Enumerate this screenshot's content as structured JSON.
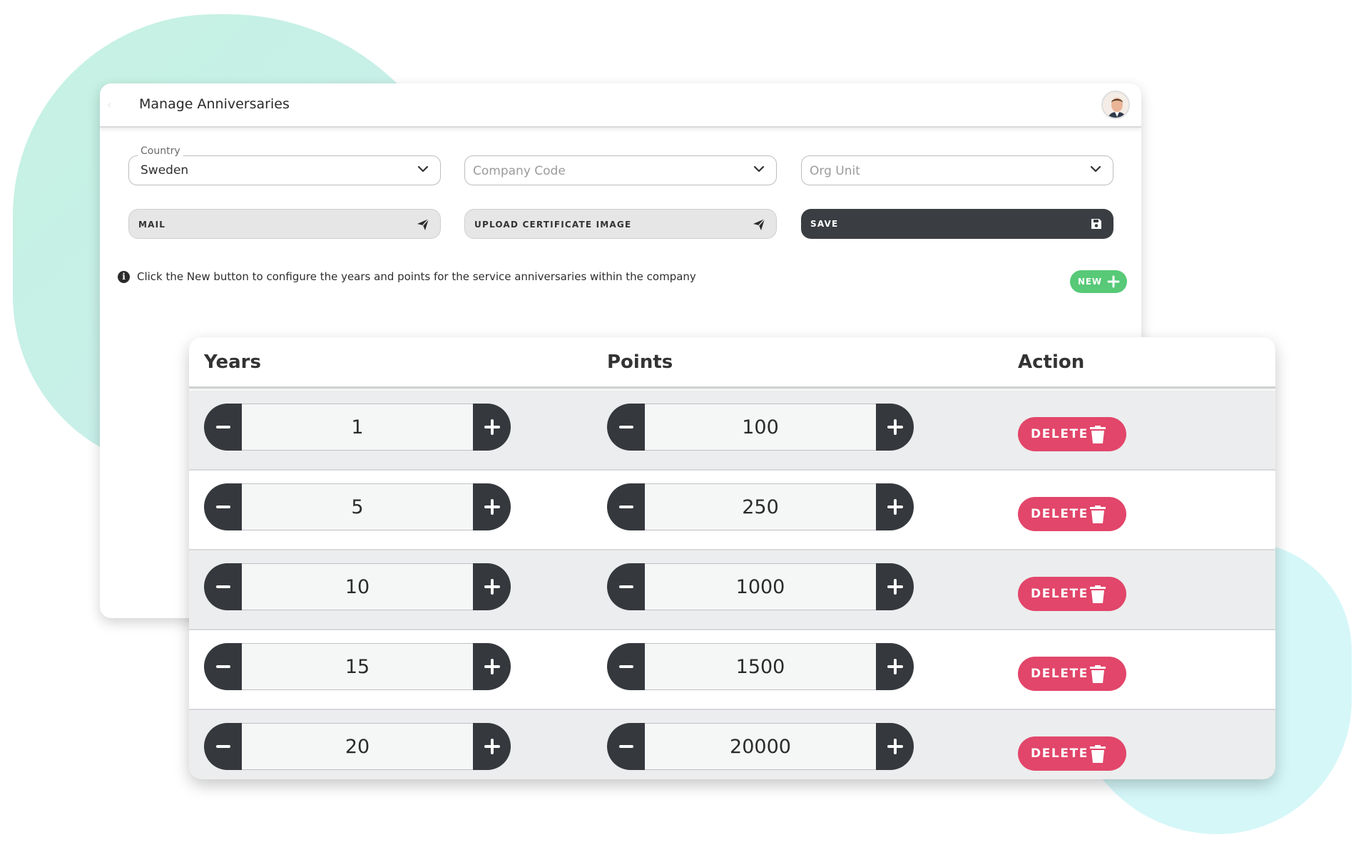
{
  "header": {
    "title": "Manage Anniversaries",
    "back_icon": "chevron-left-icon",
    "avatar_icon": "user-avatar"
  },
  "filters": {
    "country": {
      "label": "Country",
      "value": "Sweden"
    },
    "company_code": {
      "placeholder": "Company Code"
    },
    "org_unit": {
      "placeholder": "Org Unit"
    }
  },
  "actions": {
    "mail_label": "MAIL",
    "upload_label": "UPLOAD CERTIFICATE IMAGE",
    "save_label": "SAVE"
  },
  "info": {
    "text": "Click the New button to configure the years and points for the service anniversaries within the company"
  },
  "new_button": {
    "label": "NEW"
  },
  "table": {
    "headers": {
      "years": "Years",
      "points": "Points",
      "action": "Action"
    },
    "delete_label": "DELETE",
    "rows": [
      {
        "years": "1",
        "points": "100"
      },
      {
        "years": "5",
        "points": "250"
      },
      {
        "years": "10",
        "points": "1000"
      },
      {
        "years": "15",
        "points": "1500"
      },
      {
        "years": "20",
        "points": "20000"
      }
    ]
  },
  "colors": {
    "accent_delete": "#e2466a",
    "accent_new": "#57c977",
    "dark_button": "#3a3d42"
  }
}
